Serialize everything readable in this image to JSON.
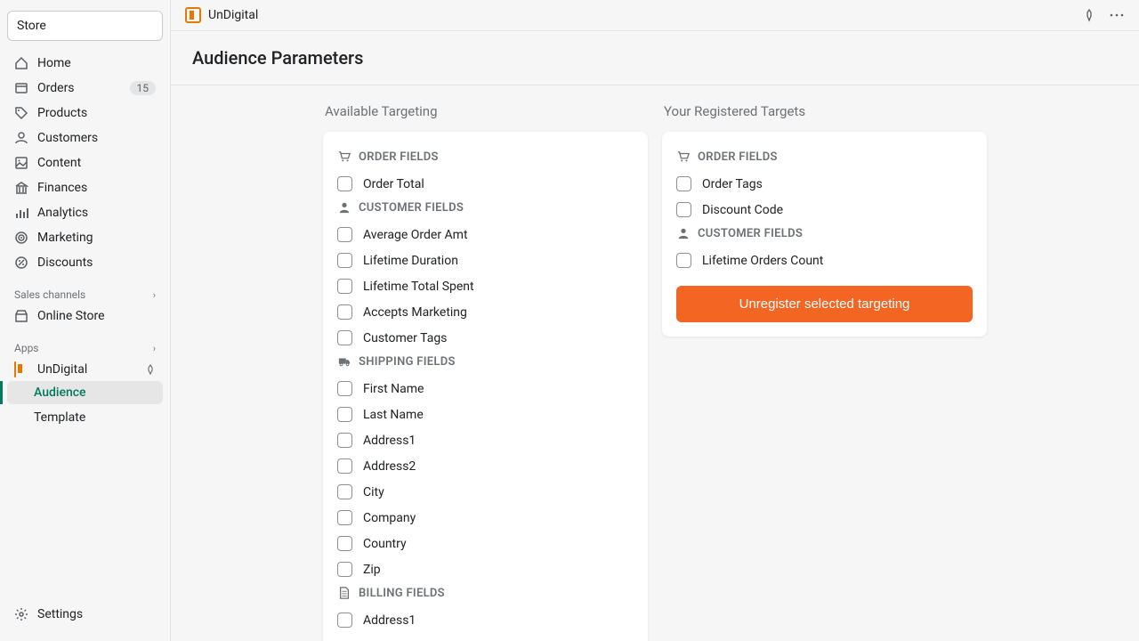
{
  "store_label": "Store",
  "nav": [
    {
      "icon": "home",
      "label": "Home"
    },
    {
      "icon": "orders",
      "label": "Orders",
      "badge": "15"
    },
    {
      "icon": "products",
      "label": "Products"
    },
    {
      "icon": "customers",
      "label": "Customers"
    },
    {
      "icon": "content",
      "label": "Content"
    },
    {
      "icon": "finances",
      "label": "Finances"
    },
    {
      "icon": "analytics",
      "label": "Analytics"
    },
    {
      "icon": "marketing",
      "label": "Marketing"
    },
    {
      "icon": "discounts",
      "label": "Discounts"
    }
  ],
  "sales_channels_label": "Sales channels",
  "online_store_label": "Online Store",
  "apps_label": "Apps",
  "app_name": "UnDigital",
  "app_subnav": [
    {
      "label": "Audience",
      "active": true
    },
    {
      "label": "Template",
      "active": false
    }
  ],
  "settings_label": "Settings",
  "topbar": {
    "title": "UnDigital"
  },
  "page": {
    "title": "Audience Parameters"
  },
  "left_column": {
    "title": "Available Targeting",
    "groups": [
      {
        "header": "ORDER FIELDS",
        "icon": "cart",
        "items": [
          "Order Total"
        ]
      },
      {
        "header": "CUSTOMER FIELDS",
        "icon": "user",
        "items": [
          "Average Order Amt",
          "Lifetime Duration",
          "Lifetime Total Spent",
          "Accepts Marketing",
          "Customer Tags"
        ]
      },
      {
        "header": "SHIPPING FIELDS",
        "icon": "truck",
        "items": [
          "First Name",
          "Last Name",
          "Address1",
          "Address2",
          "City",
          "Company",
          "Country",
          "Zip"
        ]
      },
      {
        "header": "BILLING FIELDS",
        "icon": "file",
        "items": [
          "Address1"
        ]
      }
    ]
  },
  "right_column": {
    "title": "Your Registered Targets",
    "groups": [
      {
        "header": "ORDER FIELDS",
        "icon": "cart",
        "items": [
          "Order Tags",
          "Discount Code"
        ]
      },
      {
        "header": "CUSTOMER FIELDS",
        "icon": "user",
        "items": [
          "Lifetime Orders Count"
        ]
      }
    ],
    "button": "Unregister selected targeting"
  }
}
